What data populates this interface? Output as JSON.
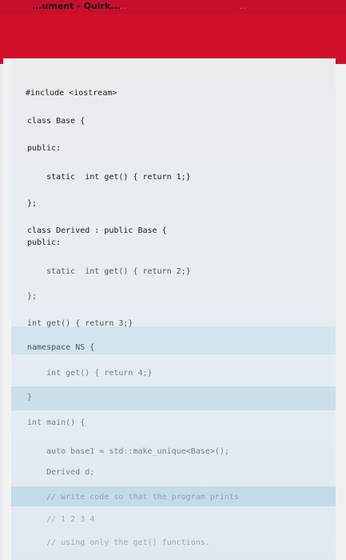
{
  "header": {
    "title": "...ument - Quirk...",
    "tab_left": "...",
    "tab_right": "..."
  },
  "code": {
    "lines": [
      "#include <iostream>",
      "class Base {",
      "public:",
      "    static  int get() { return 1;}",
      "};",
      "class Derived : public Base {",
      "public:",
      "    static  int get() { return 2;}",
      "};",
      "int get() { return 3;}",
      "namespace NS {",
      "    int get() { return 4;}",
      "}",
      "int main() {",
      "    auto base1 = std::make_unique<Base>();",
      "    Derived d;",
      "    // write code so that the program prints",
      "    // 1 2 3 4",
      "    // using only the get() functions."
    ]
  },
  "colors": {
    "topbar": "#c8102e",
    "banner": "#d0102a",
    "card": "#e9ecef"
  }
}
